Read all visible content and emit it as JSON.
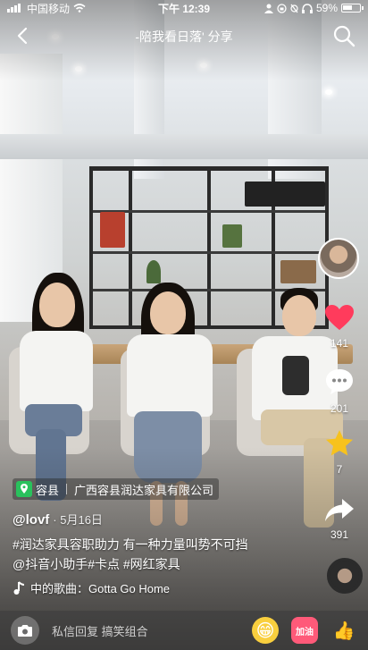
{
  "status_bar": {
    "carrier": "中国移动",
    "time": "下午 12:39",
    "battery": "59%"
  },
  "top_bar": {
    "title": "-陪我看日落' 分享",
    "back_icon": "chevron-left-icon",
    "search_icon": "search-icon"
  },
  "rail": {
    "likes": "141",
    "comments": "201",
    "favorites": "7",
    "shares": "391",
    "like_color": "#ff3b5c",
    "favorite_color": "#f7c21d"
  },
  "location": {
    "place": "容县",
    "business": "广西容县润达家具有限公司"
  },
  "author": {
    "name": "@lovf",
    "date": "· 5月16日"
  },
  "description": {
    "line1": "#润达家具容职助力 有一种力量叫势不可挡",
    "line2": "@抖音小助手#卡点 #网红家具"
  },
  "song": {
    "label": "中的歌曲：Gotta Go Home"
  },
  "comment_bar": {
    "placeholder": "私信回复 搞笑组合",
    "emoji1": "😁",
    "emoji2": "加油",
    "emoji3": "👍"
  }
}
